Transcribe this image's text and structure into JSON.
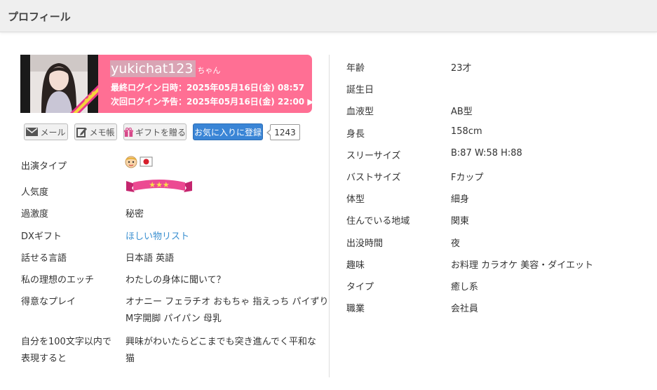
{
  "header": {
    "title": "プロフィール"
  },
  "profile": {
    "username": "yukichat123",
    "suffix": "ちゃん",
    "last_login": "最終ログイン日時：2025年05月16日(金) 08:57",
    "next_login": "次回ログイン予告：2025年05月16日(金) 22:00 ▶"
  },
  "buttons": {
    "mail": "メール",
    "memo": "メモ帳",
    "gift": "ギフトを贈る",
    "favorite": "お気に入りに登録",
    "favorite_count": "1243"
  },
  "left_info": {
    "appearance_type_label": "出演タイプ",
    "popularity_label": "人気度",
    "popularity_stars": 3,
    "intensity_label": "過激度",
    "intensity_value": "秘密",
    "dx_gift_label": "DXギフト",
    "dx_gift_value": "ほしい物リスト",
    "languages_label": "話せる言語",
    "languages_value": "日本語 英語",
    "ideal_label": "私の理想のエッチ",
    "ideal_value": "わたしの身体に聞いて？",
    "favorite_play_label": "得意なプレイ",
    "favorite_play_line1": "オナニー フェラチオ おもちゃ 指えっち パイずり",
    "favorite_play_line2": "M字開脚 パイパン 母乳",
    "self_desc_label_line1": "自分を100文字以内で",
    "self_desc_label_line2": "表現すると",
    "self_desc_line1": "興味がわいたらどこまでも突き進んでく平和な",
    "self_desc_line2": "猫"
  },
  "right_info": [
    {
      "label": "年齢",
      "value": "23才"
    },
    {
      "label": "誕生日",
      "value": ""
    },
    {
      "label": "血液型",
      "value": "AB型"
    },
    {
      "label": "身長",
      "value": "158cm"
    },
    {
      "label": "スリーサイズ",
      "value": "B:87 W:58 H:88"
    },
    {
      "label": "バストサイズ",
      "value": "Fカップ"
    },
    {
      "label": "体型",
      "value": "細身"
    },
    {
      "label": "住んでいる地域",
      "value": "関東"
    },
    {
      "label": "出没時間",
      "value": "夜"
    },
    {
      "label": "趣味",
      "value": "お料理 カラオケ 美容・ダイエット"
    },
    {
      "label": "タイプ",
      "value": "癒し系"
    },
    {
      "label": "職業",
      "value": "会社員"
    }
  ],
  "colors": {
    "card_pink": "#ff6f94",
    "favorite_blue": "#3a85d6",
    "link_blue": "#3a8fd0"
  }
}
